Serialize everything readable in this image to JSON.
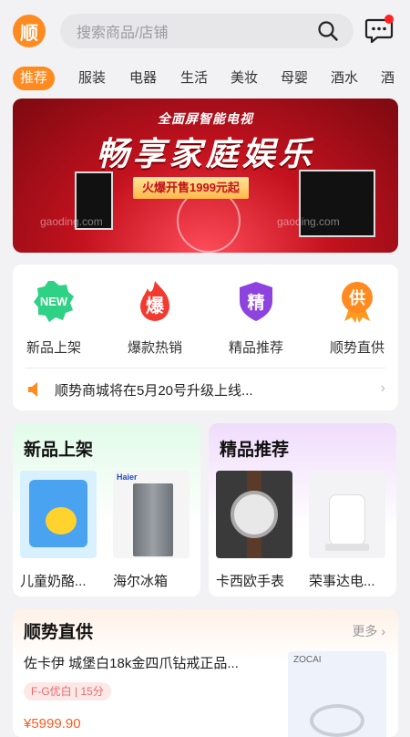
{
  "header": {
    "logo_text": "顺",
    "search_placeholder": "搜索商品/店铺"
  },
  "tabs": [
    "推荐",
    "服装",
    "电器",
    "生活",
    "美妆",
    "母婴",
    "酒水",
    "酒"
  ],
  "banner": {
    "line1": "全面屏智能电视",
    "line2": "畅享家庭娱乐",
    "line3": "火爆开售1999元起",
    "watermark": "gaoding.com"
  },
  "quick": {
    "items": [
      {
        "label": "新品上架",
        "icon": "NEW"
      },
      {
        "label": "爆款热销",
        "icon": "爆"
      },
      {
        "label": "精品推荐",
        "icon": "精"
      },
      {
        "label": "顺势直供",
        "icon": "供"
      }
    ],
    "notice": "顺势商城将在5月20号升级上线..."
  },
  "new_arrivals": {
    "title": "新品上架",
    "products": [
      {
        "name": "儿童奶酪..."
      },
      {
        "name": "海尔冰箱",
        "brand": "Haier"
      }
    ]
  },
  "featured": {
    "title": "精品推荐",
    "products": [
      {
        "name": "卡西欧手表"
      },
      {
        "name": "荣事达电..."
      }
    ]
  },
  "direct": {
    "title": "顺势直供",
    "more": "更多",
    "product_name": "佐卡伊 城堡白18k金四爪钻戒正品...",
    "tag": "F-G优白 | 15分",
    "price": "¥5999.90",
    "brand": "ZOCAI"
  },
  "colors": {
    "accent": "#ff8a1f",
    "banner_red": "#c4121f",
    "price": "#ff5a1f"
  }
}
